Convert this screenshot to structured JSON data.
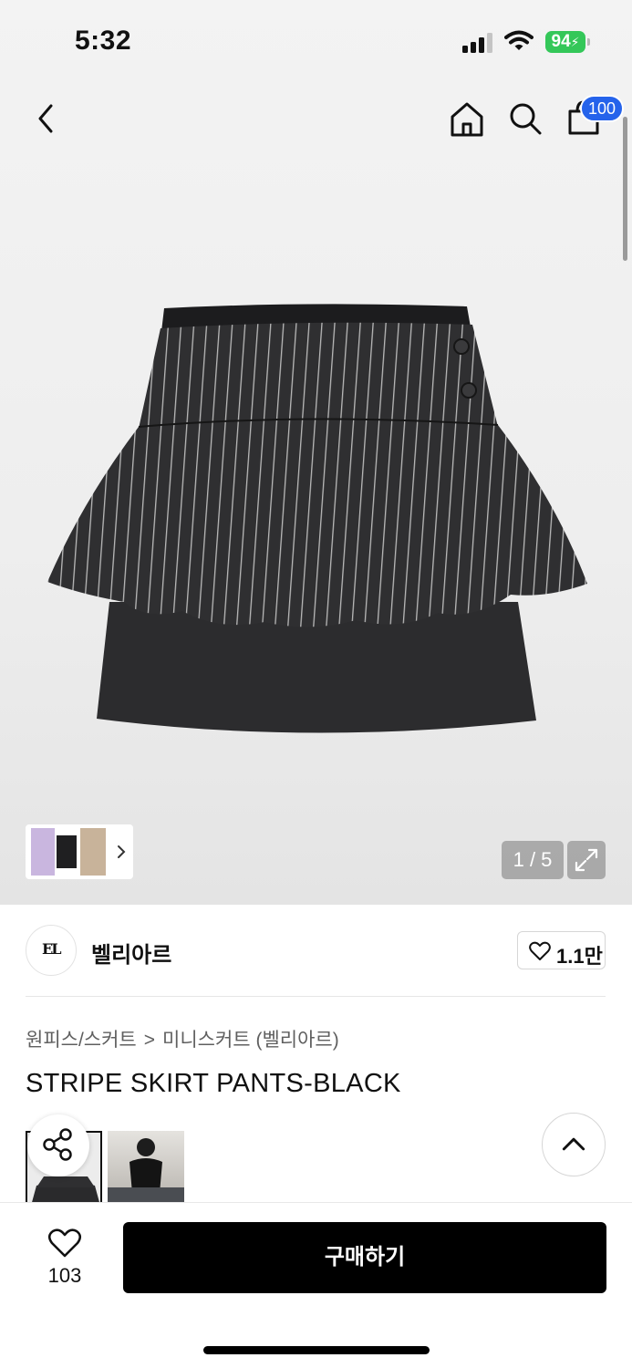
{
  "status_bar": {
    "time": "5:32",
    "battery": "94",
    "icons": [
      "cellular-signal-icon",
      "wifi-icon",
      "battery-icon"
    ]
  },
  "nav": {
    "icons": [
      "back-chevron-icon",
      "home-icon",
      "search-icon",
      "shopping-bag-icon"
    ],
    "cart_badge": "100"
  },
  "gallery": {
    "page_indicator": "1 / 5",
    "icons": [
      "chevron-right-icon",
      "expand-icon"
    ]
  },
  "brand": {
    "name": "벨리아르",
    "logo_text": "ЕL",
    "like_count": "1.1만"
  },
  "breadcrumb": {
    "category": "원피스/스커트",
    "separator": ">",
    "subcategory": "미니스커트 (벨리아르)"
  },
  "product": {
    "title": "STRIPE SKIRT PANTS-BLACK"
  },
  "actions": {
    "icons": [
      "share-icon",
      "chevron-up-icon",
      "heart-icon"
    ]
  },
  "bottom_bar": {
    "wish_count": "103",
    "buy_label": "구매하기"
  },
  "colors": {
    "accent_badge": "#2563eb",
    "battery": "#34c759",
    "buy_button": "#000000"
  }
}
